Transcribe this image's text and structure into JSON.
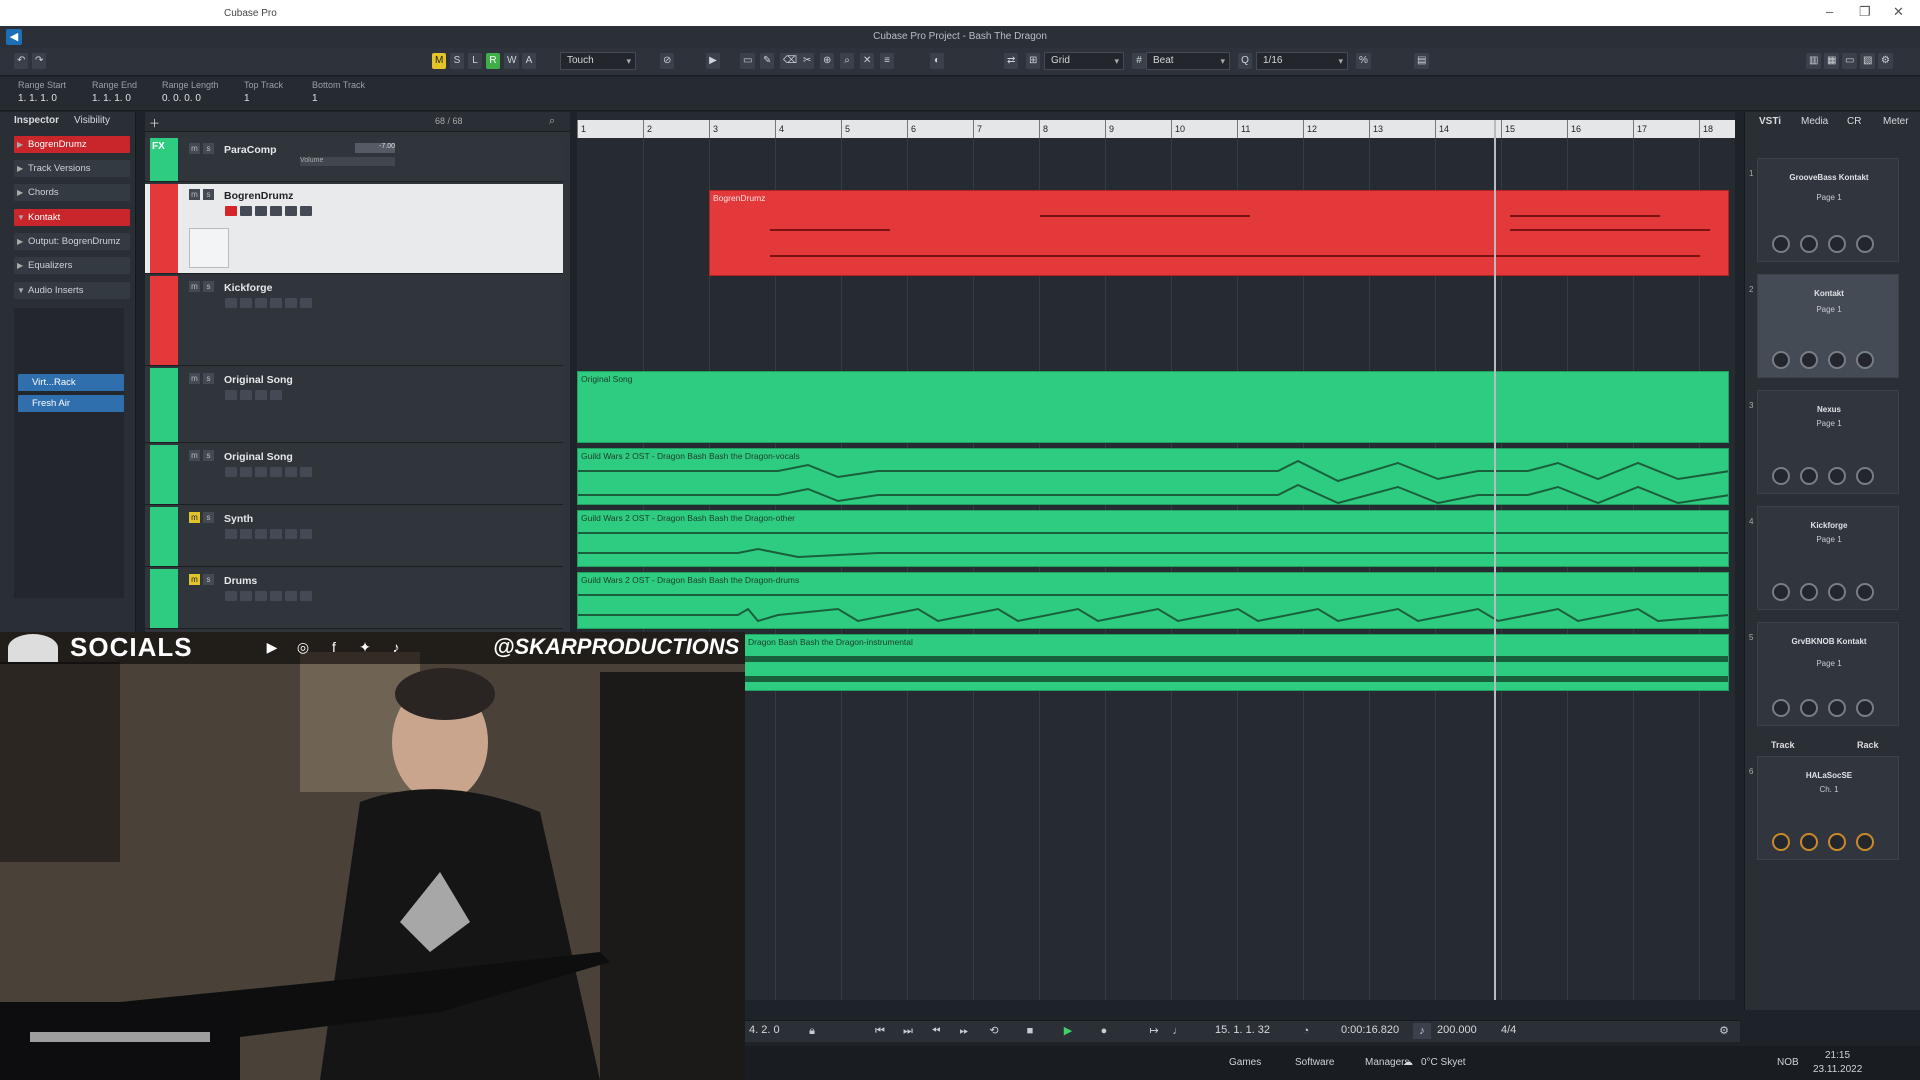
{
  "window": {
    "os_title": "Cubase Pro",
    "project_title": "Cubase Pro Project - Bash The Dragon"
  },
  "toolbar": {
    "mode_buttons": [
      "M",
      "S",
      "L",
      "R",
      "W",
      "A"
    ],
    "automation_mode": "Touch",
    "snap_type": "Grid",
    "grid_type": "Beat",
    "quantize": "1/16"
  },
  "infoline": [
    {
      "label": "Range Start",
      "value": "1. 1. 1. 0"
    },
    {
      "label": "Range End",
      "value": "1. 1. 1. 0"
    },
    {
      "label": "Range Length",
      "value": "0. 0. 0. 0"
    },
    {
      "label": "Top Track",
      "value": "1"
    },
    {
      "label": "Bottom Track",
      "value": "1"
    }
  ],
  "inspector": {
    "tabs": [
      "Inspector",
      "Visibility"
    ],
    "rows": [
      "BogrenDrumz",
      "Track Versions",
      "Chords",
      "Kontakt",
      "Output: BogrenDrumz",
      "Equalizers",
      "Audio Inserts"
    ],
    "inserts": [
      "Virt...Rack",
      "Fresh Air"
    ]
  },
  "tracklist": {
    "count": "68 / 68",
    "tracks": [
      {
        "name": "ParaComp",
        "volume": "-7.00",
        "volume_label": "Volume"
      },
      {
        "name": "BogrenDrumz"
      },
      {
        "name": "Kickforge"
      },
      {
        "name": "Original Song"
      },
      {
        "name": "Original Song"
      },
      {
        "name": "Synth"
      },
      {
        "name": "Drums"
      }
    ]
  },
  "ruler": [
    "1",
    "2",
    "3",
    "4",
    "5",
    "6",
    "7",
    "8",
    "9",
    "10",
    "11",
    "12",
    "13",
    "14",
    "15",
    "16",
    "17",
    "18"
  ],
  "events": {
    "midi": "BogrenDrumz",
    "folder": "Original Song",
    "vocals": "Guild Wars 2 OST - Dragon Bash Bash the Dragon-vocals",
    "other": "Guild Wars 2 OST - Dragon Bash Bash the Dragon-other",
    "drums": "Guild Wars 2 OST - Dragon Bash Bash the Dragon-drums",
    "instrumental": "Dragon Bash Bash the Dragon-instrumental"
  },
  "rack": {
    "tabs": [
      "VSTi",
      "Media",
      "CR",
      "Meter"
    ],
    "slots": [
      {
        "num": "1",
        "name": "GrooveBass Kontakt",
        "page": "Page 1"
      },
      {
        "num": "2",
        "name": "Kontakt",
        "page": "Page 1"
      },
      {
        "num": "3",
        "name": "Nexus",
        "page": "Page 1"
      },
      {
        "num": "4",
        "name": "Kickforge",
        "page": "Page 1"
      },
      {
        "num": "5",
        "name": "GrvBKNOB Kontakt",
        "page": "Page 1"
      },
      {
        "num": "6",
        "name": "HALaSocSE",
        "page": "Ch. 1"
      }
    ],
    "track_label": "Track",
    "rack_label": "Rack"
  },
  "stream": {
    "socials": "SOCIALS",
    "handle": "@SKARPRODUCTIONS"
  },
  "transport": {
    "left_locator": "4. 2. 0",
    "position": "15. 1. 1. 32",
    "time": "0:00:16.820",
    "tempo": "200.000",
    "signature": "4/4"
  },
  "taskbar": {
    "items": [
      "Games",
      "Software",
      "Managers"
    ],
    "weather": "0°C  Skyet",
    "lang": "NOB",
    "time": "21:15",
    "date": "23.11.2022"
  }
}
